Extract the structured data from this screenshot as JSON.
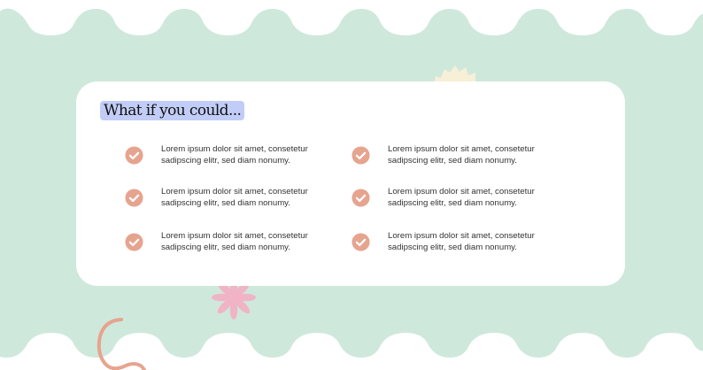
{
  "colors": {
    "wave_green": "#cfe8dc",
    "card_bg": "#ffffff",
    "title_highlight": "#c2cdf7",
    "check_circle": "#e6a48f",
    "sun_shape": "#f8efd7",
    "flower_pink": "#f0b4c6",
    "squiggle": "#e6a48f"
  },
  "card": {
    "title": "What if you could...",
    "items": [
      {
        "text": "Lorem ipsum dolor sit amet, consetetur sadipscing elitr, sed diam nonumy.",
        "icon": "check-circle-icon"
      },
      {
        "text": "Lorem ipsum dolor sit amet, consetetur sadipscing elitr, sed diam nonumy.",
        "icon": "check-circle-icon"
      },
      {
        "text": "Lorem ipsum dolor sit amet, consetetur sadipscing elitr, sed diam nonumy.",
        "icon": "check-circle-icon"
      },
      {
        "text": "Lorem ipsum dolor sit amet, consetetur sadipscing elitr, sed diam nonumy.",
        "icon": "check-circle-icon"
      },
      {
        "text": "Lorem ipsum dolor sit amet, consetetur sadipscing elitr, sed diam nonumy.",
        "icon": "check-circle-icon"
      },
      {
        "text": "Lorem ipsum dolor sit amet, consetetur sadipscing elitr, sed diam nonumy.",
        "icon": "check-circle-icon"
      }
    ]
  },
  "decorations": {
    "sun": "half-sun-icon",
    "flower": "flower-icon",
    "squiggle": "squiggle-icon"
  }
}
